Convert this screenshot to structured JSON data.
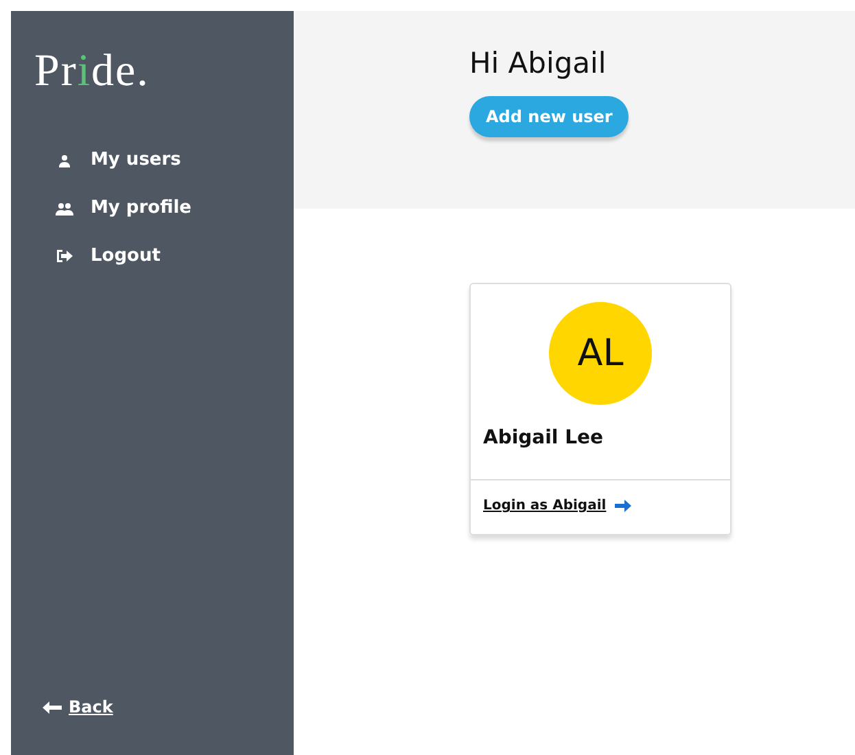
{
  "sidebar": {
    "logo": {
      "start": "Pr",
      "accent": "i",
      "end": "de."
    },
    "items": [
      {
        "label": "My users",
        "kind": "user"
      },
      {
        "label": "My profile",
        "kind": "users"
      },
      {
        "label": "Logout",
        "kind": "logout"
      }
    ],
    "back_link": "Back"
  },
  "header": {
    "greeting": "Hi Abigail",
    "button": "Add new user"
  },
  "users": [
    {
      "initials": "AL",
      "color": "#ffd600",
      "name": "Abigail Lee",
      "login_link": "Login as Abigail"
    }
  ]
}
